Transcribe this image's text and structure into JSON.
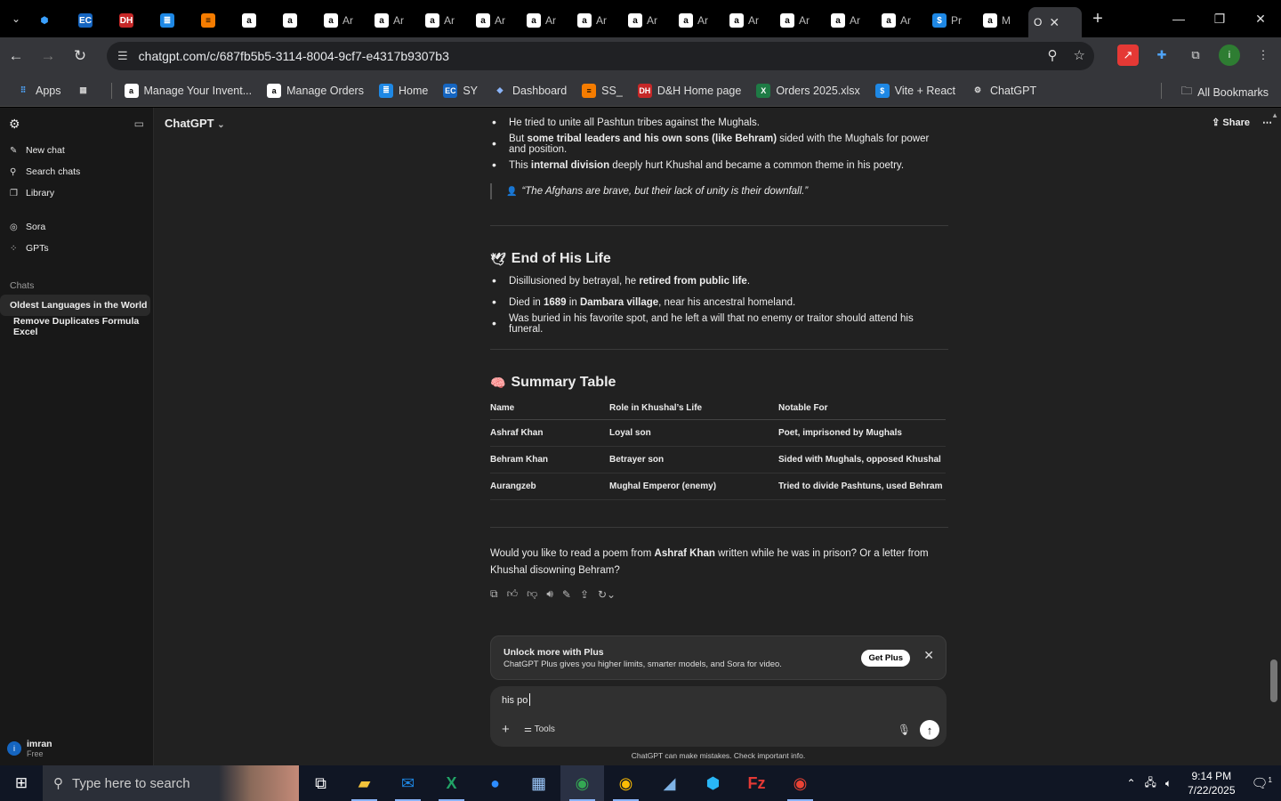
{
  "browser": {
    "tabs": [
      {
        "icon": "hex-icon",
        "label": ""
      },
      {
        "icon": "ec-icon",
        "label": ""
      },
      {
        "icon": "dh-icon",
        "label": ""
      },
      {
        "icon": "google-docs-icon",
        "label": ""
      },
      {
        "icon": "stack-icon",
        "label": ""
      },
      {
        "icon": "amazon-icon",
        "label": ""
      },
      {
        "icon": "amazon-icon",
        "label": ""
      },
      {
        "icon": "amazon-icon",
        "label": "Ar"
      },
      {
        "icon": "amazon-icon",
        "label": "Ar"
      },
      {
        "icon": "amazon-icon",
        "label": "Ar"
      },
      {
        "icon": "amazon-icon",
        "label": "Ar"
      },
      {
        "icon": "amazon-icon",
        "label": "Ar"
      },
      {
        "icon": "amazon-icon",
        "label": "Ar"
      },
      {
        "icon": "amazon-icon",
        "label": "Ar"
      },
      {
        "icon": "amazon-icon",
        "label": "Ar"
      },
      {
        "icon": "amazon-icon",
        "label": "Ar"
      },
      {
        "icon": "amazon-icon",
        "label": "Ar"
      },
      {
        "icon": "amazon-icon",
        "label": "Ar"
      },
      {
        "icon": "amazon-icon",
        "label": "Ar"
      },
      {
        "icon": "dollar-icon",
        "label": "Pr"
      },
      {
        "icon": "amazon-icon",
        "label": "M"
      }
    ],
    "active_tab": {
      "label": "O",
      "close": "✕"
    },
    "new_tab": "+",
    "url": "chatgpt.com/c/687fb5b5-3114-8004-9cf7-e4317b9307b3",
    "bookmarks": [
      {
        "label": "Apps",
        "icon": "apps-grid-icon"
      },
      {
        "label": "",
        "icon": "tab-groups-icon"
      },
      {
        "label": "Manage Your Invent...",
        "icon": "amazon-icon"
      },
      {
        "label": "Manage Orders",
        "icon": "amazon-icon"
      },
      {
        "label": "Home",
        "icon": "google-docs-icon"
      },
      {
        "label": "SY",
        "icon": "ec-icon"
      },
      {
        "label": "Dashboard",
        "icon": "cube-icon"
      },
      {
        "label": "SS_",
        "icon": "stack-icon"
      },
      {
        "label": "D&H Home page",
        "icon": "dh-icon"
      },
      {
        "label": "Orders 2025.xlsx",
        "icon": "excel-icon"
      },
      {
        "label": "Vite + React",
        "icon": "dollar-icon"
      },
      {
        "label": "ChatGPT",
        "icon": "openai-icon"
      }
    ],
    "all_bookmarks": "All Bookmarks",
    "profile_initial": "i"
  },
  "sidebar": {
    "items": [
      {
        "label": "New chat",
        "icon": "pencil-icon"
      },
      {
        "label": "Search chats",
        "icon": "search-icon"
      },
      {
        "label": "Library",
        "icon": "library-icon"
      }
    ],
    "items2": [
      {
        "label": "Sora",
        "icon": "sora-icon"
      },
      {
        "label": "GPTs",
        "icon": "gpts-icon"
      }
    ],
    "chats_label": "Chats",
    "chats": [
      {
        "label": "Oldest Languages in the World",
        "active": true
      },
      {
        "label": "Remove Duplicates Formula Excel",
        "active": false
      }
    ],
    "user": {
      "name": "imran",
      "plan": "Free",
      "initial": "i"
    }
  },
  "header": {
    "model": "ChatGPT",
    "share": "Share"
  },
  "content": {
    "top_bullets": [
      [
        "He tried to unite all Pashtun tribes against the Mughals."
      ],
      [
        "But ",
        "some tribal leaders and his own sons (like Behram)",
        " sided with the Mughals for power and position."
      ],
      [
        "This ",
        "internal division",
        " deeply hurt Khushal and became a common theme in his poetry."
      ]
    ],
    "quote": "“The Afghans are brave, but their lack of unity is their downfall.”",
    "section1": {
      "emoji": "🕊",
      "title": "End of His Life",
      "bullets": [
        [
          "Disillusioned by betrayal, he ",
          "retired from public life",
          "."
        ],
        [
          "Died in ",
          "1689",
          " in ",
          "Dambara village",
          ", near his ancestral homeland."
        ],
        [
          "Was buried in his favorite spot, and he left a will that no enemy or traitor should attend his funeral."
        ]
      ]
    },
    "section2": {
      "emoji": "🧠",
      "title": "Summary Table",
      "columns": [
        "Name",
        "Role in Khushal’s Life",
        "Notable For"
      ],
      "rows": [
        [
          "Ashraf Khan",
          "Loyal son",
          "Poet, imprisoned by Mughals"
        ],
        [
          "Behram Khan",
          "Betrayer son",
          "Sided with Mughals, opposed Khushal"
        ],
        [
          "Aurangzeb",
          "Mughal Emperor (enemy)",
          "Tried to divide Pashtuns, used Behram"
        ]
      ]
    },
    "closing": [
      "Would you like to read a poem from ",
      "Ashraf Khan",
      " written while he was in prison? Or a letter from Khushal disowning Behram?"
    ]
  },
  "banner": {
    "title": "Unlock more with Plus",
    "body": "ChatGPT Plus gives you higher limits, smarter models, and Sora for video.",
    "button": "Get Plus"
  },
  "composer": {
    "value": "his po",
    "tools": "Tools"
  },
  "disclaimer": "ChatGPT can make mistakes. Check important info.",
  "taskbar": {
    "search_placeholder": "Type here to search",
    "time": "9:14 PM",
    "date": "7/22/2025",
    "notifications": "1"
  },
  "colors": {
    "bg": "#212121",
    "sidebar": "#181818",
    "accent": "#ffffff"
  }
}
